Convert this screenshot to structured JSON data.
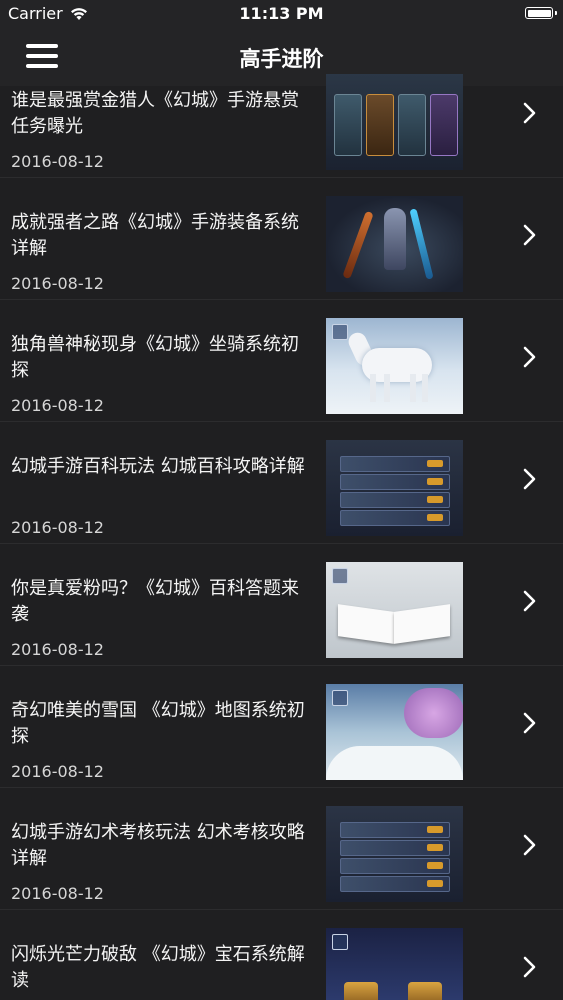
{
  "status_bar": {
    "carrier": "Carrier",
    "time": "11:13 PM",
    "wifi_icon": "wifi-icon",
    "battery_icon": "battery-icon"
  },
  "nav": {
    "title": "高手进阶",
    "menu_icon": "hamburger-menu-icon"
  },
  "articles": [
    {
      "title": "谁是最强赏金猎人《幻城》手游悬赏任务曝光",
      "date": "2016-08-12"
    },
    {
      "title": "成就强者之路《幻城》手游装备系统详解",
      "date": "2016-08-12"
    },
    {
      "title": "独角兽神秘现身《幻城》坐骑系统初探",
      "date": "2016-08-12"
    },
    {
      "title": "幻城手游百科玩法 幻城百科攻略详解",
      "date": "2016-08-12"
    },
    {
      "title": "你是真爱粉吗？《幻城》百科答题来袭",
      "date": "2016-08-12"
    },
    {
      "title": "奇幻唯美的雪国 《幻城》地图系统初探",
      "date": "2016-08-12"
    },
    {
      "title": "幻城手游幻术考核玩法 幻术考核攻略详解",
      "date": "2016-08-12"
    },
    {
      "title": "闪烁光芒力破敌 《幻城》宝石系统解读",
      "date": ""
    }
  ],
  "theme": {
    "background": "#1f1f21",
    "bar": "#242426",
    "text": "#ffffff",
    "secondary_text": "#d6d6d6"
  }
}
